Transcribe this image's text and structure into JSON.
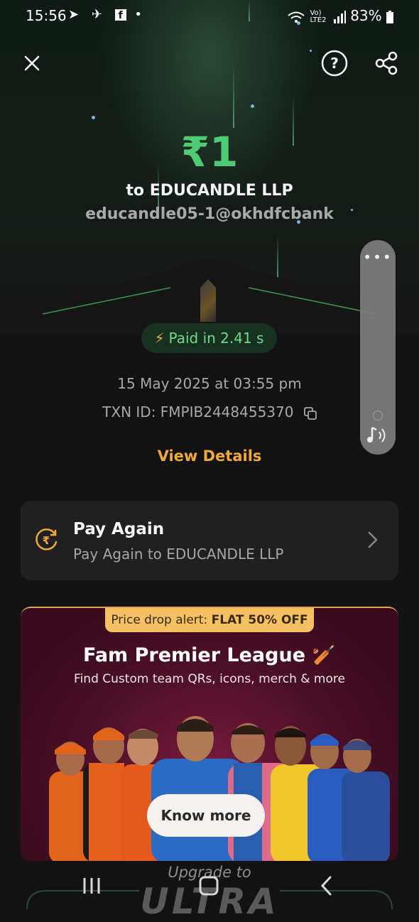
{
  "status_bar": {
    "time": "15:56",
    "left_icons": [
      "telegram-icon",
      "navigation-icon",
      "facebook-icon",
      "dot-icon"
    ],
    "network_label": "Vo) LTE2",
    "battery": "83%"
  },
  "header": {
    "close_icon": "close-icon",
    "help_icon": "help-icon",
    "share_icon": "share-icon"
  },
  "payment": {
    "amount": "₹1",
    "recipient_line": "to EDUCANDLE LLP",
    "upi_id": "educandle05-1@okhdfcbank",
    "paid_in": "Paid in 2.41 s",
    "date_time": "15 May 2025 at 03:55 pm",
    "txn_id": "TXN ID: FMPIB2448455370",
    "view_details": "View Details"
  },
  "pay_again": {
    "title": "Pay Again",
    "subtitle": "Pay Again to EDUCANDLE LLP"
  },
  "promo": {
    "tag_prefix": "Price drop alert: ",
    "tag_bold": "FLAT 50% OFF",
    "title": "Fam Premier League 🏏",
    "subtitle": "Find Custom team QRs, icons, merch & more",
    "cta": "Know more"
  },
  "footer": {
    "upgrade_text": "Upgrade to",
    "brand_text": "ULTRA"
  },
  "colors": {
    "amount_green": "#4fcb73",
    "accent_orange": "#f1a938",
    "card_bg": "#202020",
    "promo_tag": "#f6c163"
  }
}
